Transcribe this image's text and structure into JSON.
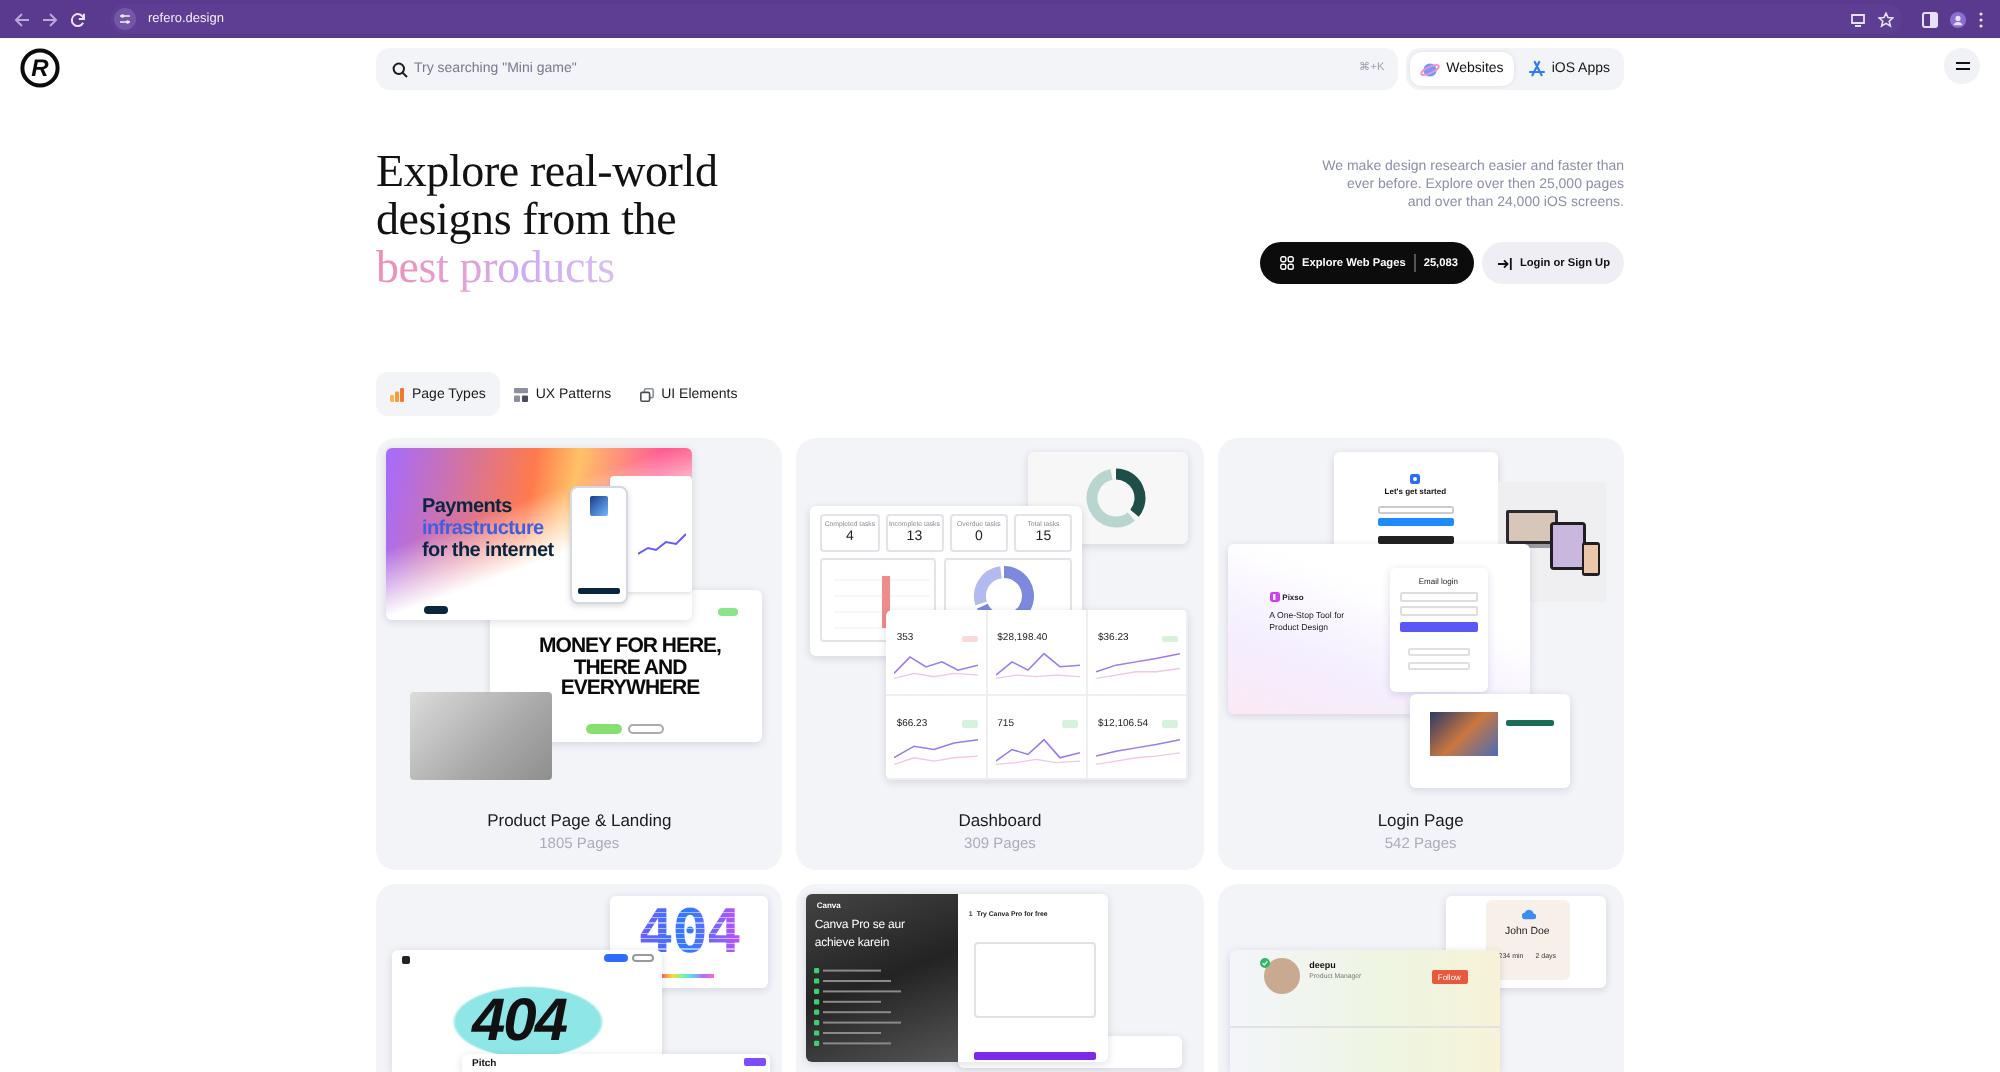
{
  "browser": {
    "url": "refero.design"
  },
  "header": {
    "logo": "R",
    "search": {
      "placeholder": "Try searching \"Mini game\"",
      "shortcut": "⌘+K"
    },
    "platforms": [
      {
        "label": "Websites",
        "selected": true
      },
      {
        "label": "iOS Apps",
        "selected": false
      }
    ]
  },
  "hero": {
    "headline": [
      "Explore real-world",
      "designs from the"
    ],
    "accent": "best products",
    "intro": [
      "We make design research easier and faster than",
      "ever before. Explore over then 25,000 pages",
      "and over than 24,000 iOS screens."
    ],
    "primary_button": {
      "label": "Explore Web Pages",
      "count": "25,083"
    },
    "secondary_button": {
      "label": "Login or Sign Up"
    }
  },
  "tabs": [
    {
      "label": "Page Types",
      "selected": true
    },
    {
      "label": "UX Patterns",
      "selected": false
    },
    {
      "label": "UI Elements",
      "selected": false
    }
  ],
  "cards": [
    {
      "kind": "landing",
      "title": "Product Page & Landing",
      "count": "1805 Pages",
      "preview": {
        "heading": [
          "Payments",
          "infrastructure",
          "for the internet"
        ],
        "banner": "MONEY FOR HERE, THERE AND EVERYWHERE"
      }
    },
    {
      "kind": "dashboard",
      "title": "Dashboard",
      "count": "309 Pages",
      "preview": {
        "stats": [
          {
            "label": "Completed tasks",
            "value": "4"
          },
          {
            "label": "Incomplete tasks",
            "value": "13"
          },
          {
            "label": "Overdue tasks",
            "value": "0"
          },
          {
            "label": "Total tasks",
            "value": "15"
          }
        ],
        "metrics": [
          {
            "value": "353",
            "color": "#fbd9d9"
          },
          {
            "value": "$28,198.40"
          },
          {
            "value": "$36.23",
            "color": "#d6f2dc"
          },
          {
            "value": "$66.23",
            "color": "#d6f2dc"
          },
          {
            "value": "715",
            "color": "#d6f2dc"
          },
          {
            "value": "$12,106.54",
            "color": "#d6f2dc"
          }
        ]
      }
    },
    {
      "kind": "login",
      "title": "Login Page",
      "count": "542 Pages",
      "preview": {
        "welcome": "Let's get started",
        "brand": "Pixso",
        "tagline": "A One-Stop Tool for Product Design",
        "form_title": "Email login"
      }
    },
    {
      "kind": "error",
      "preview": {
        "pixel_code": "404",
        "graffiti_code": "404",
        "brand": "Pitch"
      }
    },
    {
      "kind": "signup",
      "preview": {
        "brand": "Canva",
        "headline": "Canva Pro se aur achieve karein",
        "form_step": "1",
        "form_title": "Try Canva Pro for free"
      }
    },
    {
      "kind": "profile",
      "preview": {
        "contact_name": "John Doe",
        "stats": [
          "234 min",
          "2 days"
        ],
        "name": "deepu",
        "role": "Product Manager",
        "button": "Follow"
      }
    }
  ]
}
